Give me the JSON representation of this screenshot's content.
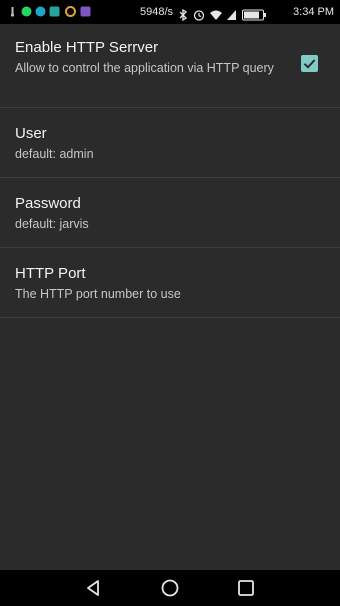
{
  "status_bar": {
    "network_speed": "5948/s",
    "time": "3:34 PM",
    "icons": [
      "usb-icon",
      "whatsapp-icon",
      "gallery-icon",
      "settings-icon",
      "app-icon",
      "bluetooth-icon",
      "alarm-icon",
      "wifi-icon",
      "signal-icon",
      "battery-icon"
    ]
  },
  "preferences": [
    {
      "title": "Enable HTTP Serrver",
      "summary": "Allow to control the application via HTTP query",
      "checked": true
    },
    {
      "title": "User",
      "summary": "default: admin"
    },
    {
      "title": "Password",
      "summary": "default: jarvis"
    },
    {
      "title": "HTTP Port",
      "summary": "The HTTP port number to use"
    }
  ],
  "nav_bar": {
    "icons": [
      "back-icon",
      "home-icon",
      "recents-icon"
    ]
  },
  "colors": {
    "background": "#2b2b2b",
    "accent": "#80cbc4",
    "divider": "#3e3e3e"
  }
}
